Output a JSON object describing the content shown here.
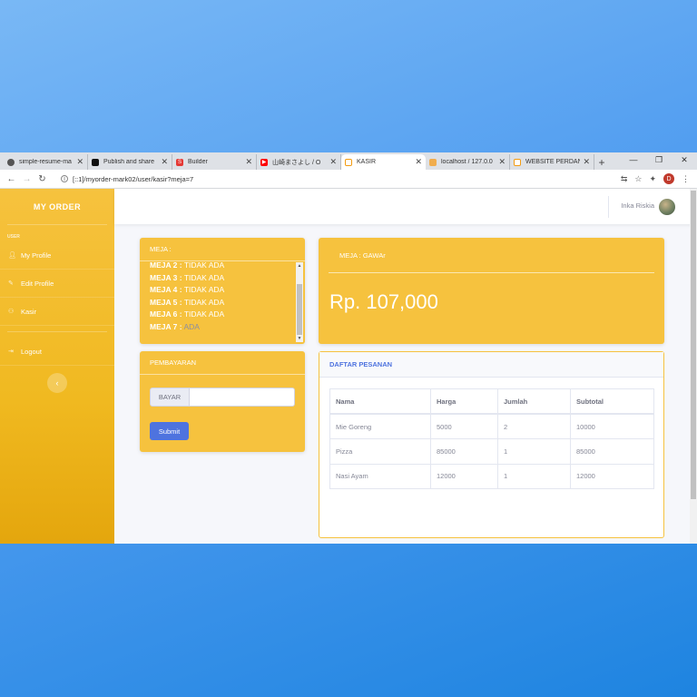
{
  "browser": {
    "tabs": [
      {
        "title": "simple-resume-ma",
        "favicon_color": "#444444",
        "favicon": "globe-icon"
      },
      {
        "title": "Publish and share",
        "favicon_color": "#111111",
        "favicon": "medium-icon"
      },
      {
        "title": "Builder",
        "favicon_color": "#e53935",
        "favicon": "builder-icon"
      },
      {
        "title": "山崎まさよし / O",
        "favicon_color": "#ff0000",
        "favicon": "youtube-icon"
      },
      {
        "title": "KASIR",
        "favicon_color": "#f39c12",
        "favicon": "kasir-icon"
      },
      {
        "title": "localhost / 127.0.0",
        "favicon_color": "#f0ad4e",
        "favicon": "phpmyadmin-icon"
      },
      {
        "title": "WEBSITE PERDANA",
        "favicon_color": "#f39c12",
        "favicon": "website-icon"
      }
    ],
    "url": "[::1]/myorder-mark02/user/kasir?meja=7",
    "profile_initial": "D"
  },
  "sidebar": {
    "brand": "MY ORDER",
    "heading": "USER",
    "items": [
      {
        "label": "My Profile",
        "icon": "user-icon"
      },
      {
        "label": "Edit Profile",
        "icon": "user-edit-icon"
      },
      {
        "label": "Kasir",
        "icon": "users-icon"
      },
      {
        "label": "Logout",
        "icon": "logout-icon"
      }
    ]
  },
  "topbar": {
    "username": "Inka Riskia"
  },
  "meja": {
    "title": "MEJA :",
    "rows": [
      {
        "label": "MEJA 2 :",
        "status": "TIDAK ADA"
      },
      {
        "label": "MEJA 3 :",
        "status": "TIDAK ADA"
      },
      {
        "label": "MEJA 4 :",
        "status": "TIDAK ADA"
      },
      {
        "label": "MEJA 5 :",
        "status": "TIDAK ADA"
      },
      {
        "label": "MEJA 6 :",
        "status": "TIDAK ADA"
      },
      {
        "label": "MEJA 7 :",
        "status": "ADA"
      }
    ]
  },
  "total": {
    "title": "MEJA : GAWAr",
    "amount": "Rp. 107,000"
  },
  "pembayaran": {
    "title": "PEMBAYARAN",
    "input_prefix": "BAYAR",
    "input_value": "",
    "submit_label": "Submit"
  },
  "pesanan": {
    "title": "DAFTAR PESANAN",
    "columns": [
      "Nama",
      "Harga",
      "Jumlah",
      "Subtotal"
    ],
    "rows": [
      [
        "Mie Goreng",
        "5000",
        "2",
        "10000"
      ],
      [
        "Pizza",
        "85000",
        "1",
        "85000"
      ],
      [
        "Nasi Ayam",
        "12000",
        "1",
        "12000"
      ]
    ]
  },
  "colors": {
    "accent": "#f6c23e",
    "primary": "#4e73df",
    "text_muted": "#858796"
  }
}
